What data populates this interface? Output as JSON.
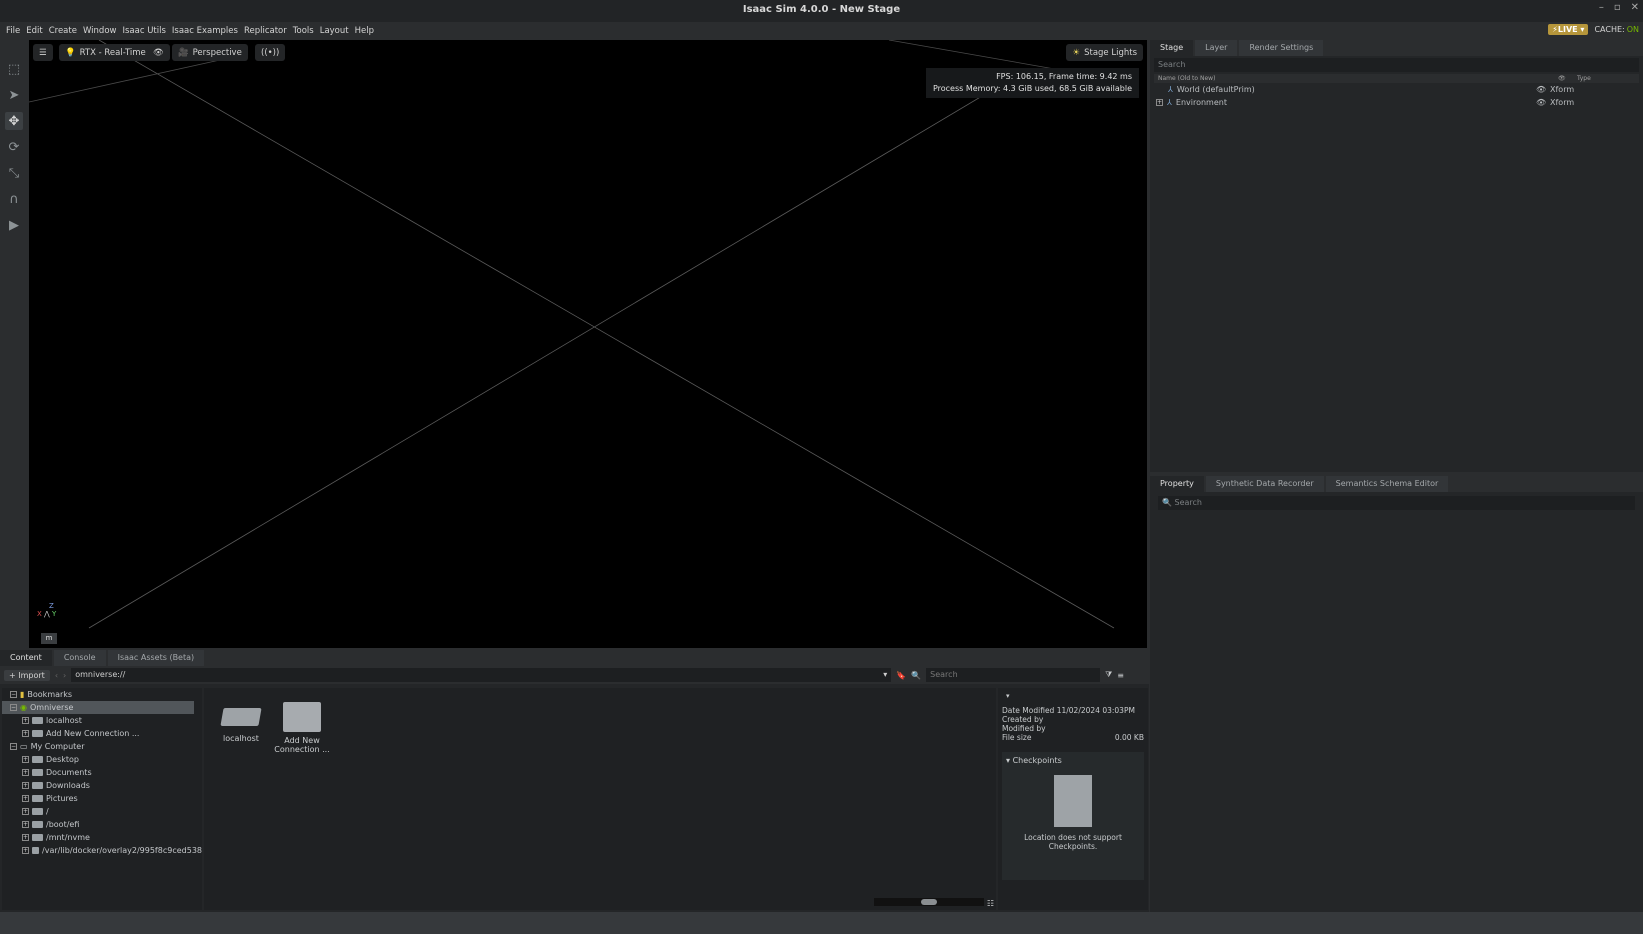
{
  "window": {
    "title": "Isaac Sim 4.0.0 - New Stage"
  },
  "menu": {
    "items": [
      "File",
      "Edit",
      "Create",
      "Window",
      "Isaac Utils",
      "Isaac Examples",
      "Replicator",
      "Tools",
      "Layout",
      "Help"
    ],
    "live_label": "LIVE",
    "cache_label": "CACHE:",
    "cache_state": "ON"
  },
  "viewport": {
    "renderer": "RTX - Real-Time",
    "camera": "Perspective",
    "stage_lights": "Stage Lights",
    "fps_line": "FPS: 106.15, Frame time: 9.42 ms",
    "memory_line": "Process Memory: 4.3 GiB used, 68.5 GiB available",
    "axis": {
      "z": "Z",
      "x": "X",
      "y": "Y"
    },
    "unit": "m"
  },
  "stage": {
    "tabs": [
      "Stage",
      "Layer",
      "Render Settings"
    ],
    "search_placeholder": "Search",
    "col_name": "Name (Old to New)",
    "col_type": "Type",
    "rows": [
      {
        "name": "World (defaultPrim)",
        "type": "Xform"
      },
      {
        "name": "Environment",
        "type": "Xform"
      }
    ]
  },
  "property": {
    "tabs": [
      "Property",
      "Synthetic Data Recorder",
      "Semantics Schema Editor"
    ],
    "search_placeholder": "Search"
  },
  "content": {
    "tabs": [
      "Content",
      "Console",
      "Isaac Assets (Beta)"
    ],
    "import_label": "Import",
    "path": "omniverse://",
    "search_placeholder": "Search",
    "tree": [
      {
        "label": "Bookmarks",
        "level": 0
      },
      {
        "label": "Omniverse",
        "level": 0
      },
      {
        "label": "localhost",
        "level": 1
      },
      {
        "label": "Add New Connection ...",
        "level": 1
      },
      {
        "label": "My Computer",
        "level": 0
      },
      {
        "label": "Desktop",
        "level": 1
      },
      {
        "label": "Documents",
        "level": 1
      },
      {
        "label": "Downloads",
        "level": 1
      },
      {
        "label": "Pictures",
        "level": 1
      },
      {
        "label": "/",
        "level": 1
      },
      {
        "label": "/boot/efi",
        "level": 1
      },
      {
        "label": "/mnt/nvme",
        "level": 1
      },
      {
        "label": "/var/lib/docker/overlay2/995f8c9ced538",
        "level": 1
      }
    ],
    "grid": [
      {
        "label": "localhost"
      },
      {
        "label": "Add New Connection ..."
      }
    ],
    "info": {
      "date_modified_label": "Date Modified",
      "date_modified": "11/02/2024 03:03PM",
      "created_by_label": "Created by",
      "modified_by_label": "Modified by",
      "file_size_label": "File size",
      "file_size": "0.00 KB",
      "checkpoints_label": "Checkpoints",
      "checkpoints_msg": "Location does not support Checkpoints."
    }
  }
}
